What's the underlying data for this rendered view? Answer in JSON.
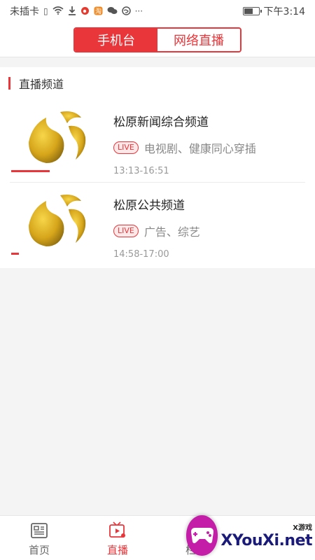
{
  "status_bar": {
    "carrier": "未插卡",
    "time": "下午3:14",
    "icons": [
      "sim-icon",
      "wifi-icon",
      "download-icon",
      "weibo-icon",
      "taobao-icon",
      "wechat-icon",
      "browser-icon",
      "more-icon"
    ],
    "more": "···",
    "battery_level": 0.6
  },
  "header": {
    "tabs": [
      {
        "label": "手机台",
        "active": true
      },
      {
        "label": "网络直播",
        "active": false
      }
    ]
  },
  "section": {
    "title": "直播频道"
  },
  "channels": [
    {
      "name": "松原新闻综合频道",
      "badge": "LIVE",
      "program": "电视剧、健康同心穿插",
      "time": "13:13-16:51",
      "progress": 0.5
    },
    {
      "name": "松原公共频道",
      "badge": "LIVE",
      "program": "广告、综艺",
      "time": "14:58-17:00",
      "progress": 0.1
    }
  ],
  "bottom_nav": {
    "items": [
      {
        "label": "首页",
        "icon": "news-icon",
        "active": false
      },
      {
        "label": "直播",
        "icon": "live-tv-icon",
        "active": true
      },
      {
        "label": "栏目",
        "icon": "palette-icon",
        "active": false
      }
    ]
  },
  "watermark": {
    "small": "X游戏",
    "big": "XYouXi.net"
  },
  "colors": {
    "accent": "#e8363a",
    "logo_gold": "#d6a51a"
  }
}
